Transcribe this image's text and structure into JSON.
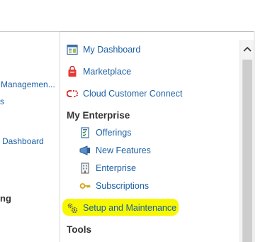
{
  "background_panel": {
    "items": [
      {
        "text": "Managemen...",
        "style": "link"
      },
      {
        "text": "s",
        "style": "link"
      },
      {
        "text": "Dashboard",
        "style": "link"
      },
      {
        "text": "ng",
        "style": "bold"
      }
    ]
  },
  "navigator": {
    "top_items": [
      {
        "label": "My Dashboard",
        "icon": "dashboard-icon"
      },
      {
        "label": "Marketplace",
        "icon": "marketplace-bag-icon"
      },
      {
        "label": "Cloud Customer Connect",
        "icon": "connect-link-icon"
      }
    ],
    "my_enterprise": {
      "heading": "My Enterprise",
      "items": [
        {
          "label": "Offerings",
          "icon": "offerings-icon"
        },
        {
          "label": "New Features",
          "icon": "new-features-icon"
        },
        {
          "label": "Enterprise",
          "icon": "enterprise-icon"
        },
        {
          "label": "Subscriptions",
          "icon": "key-icon"
        },
        {
          "label": "Setup and Maintenance",
          "icon": "gears-icon",
          "highlighted": true
        }
      ]
    },
    "tools": {
      "heading": "Tools"
    }
  },
  "colors": {
    "link": "#1c5fa4",
    "heading": "#333333",
    "highlight": "#f7f700",
    "scroll_thumb": "#cdcdcd"
  }
}
